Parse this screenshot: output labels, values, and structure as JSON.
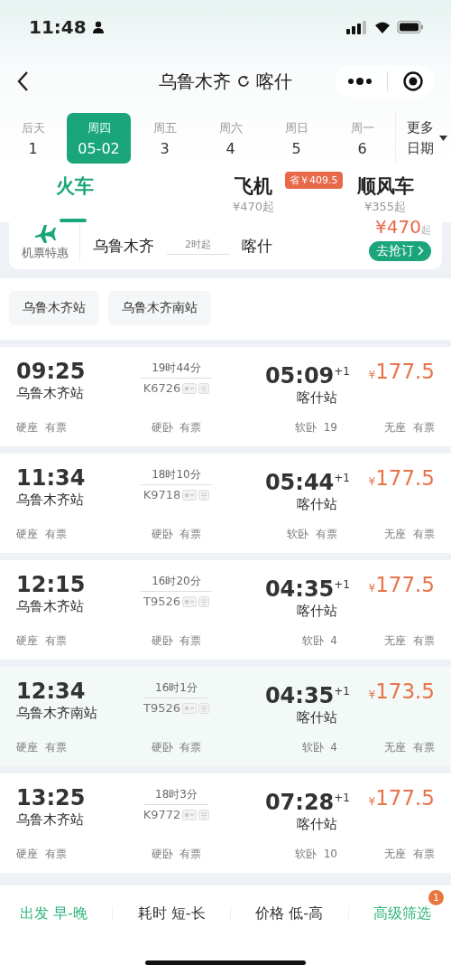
{
  "status_bar": {
    "time": "11:48"
  },
  "nav": {
    "from": "乌鲁木齐",
    "to": "喀什"
  },
  "dates": [
    {
      "weekday": "后天",
      "date": "1",
      "selected": false
    },
    {
      "weekday": "周四",
      "date": "05-02",
      "selected": true
    },
    {
      "weekday": "周五",
      "date": "3",
      "selected": false
    },
    {
      "weekday": "周六",
      "date": "4",
      "selected": false
    },
    {
      "weekday": "周日",
      "date": "5",
      "selected": false
    },
    {
      "weekday": "周一",
      "date": "6",
      "selected": false
    }
  ],
  "more_dates": {
    "line_1": "更多",
    "line_2": "日期"
  },
  "tabs": [
    {
      "label": "火车",
      "selected": true
    },
    {
      "label": "飞机",
      "price": "¥470起",
      "badge": "省￥409.5",
      "selected": false
    },
    {
      "label": "顺风车",
      "price": "¥355起",
      "selected": false
    }
  ],
  "flight_promo": {
    "label": "机票特惠",
    "from": "乌鲁木齐",
    "duration": "2时起",
    "to": "喀什",
    "price": "¥470",
    "price_suffix": "起",
    "button": "去抢订"
  },
  "station_filters": [
    {
      "label": "乌鲁木齐站",
      "selected": false
    },
    {
      "label": "乌鲁木齐南站",
      "selected": false
    }
  ],
  "trains": [
    {
      "depart": "09:25",
      "from": "乌鲁木齐站",
      "duration": "19时44分",
      "number": "K6726",
      "arrive": "05:09",
      "day_offset": "+1",
      "to": "喀什站",
      "price": "177.5",
      "currency": "¥",
      "selected": false,
      "seats": [
        {
          "type": "硬座",
          "status": "有票"
        },
        {
          "type": "硬卧",
          "status": "有票"
        },
        {
          "type": "软卧",
          "status": "19"
        },
        {
          "type": "无座",
          "status": "有票"
        }
      ]
    },
    {
      "depart": "11:34",
      "from": "乌鲁木齐站",
      "duration": "18时10分",
      "number": "K9718",
      "arrive": "05:44",
      "day_offset": "+1",
      "to": "喀什站",
      "price": "177.5",
      "currency": "¥",
      "selected": false,
      "seats": [
        {
          "type": "硬座",
          "status": "有票"
        },
        {
          "type": "硬卧",
          "status": "有票"
        },
        {
          "type": "软卧",
          "status": "有票"
        },
        {
          "type": "无座",
          "status": "有票"
        }
      ]
    },
    {
      "depart": "12:15",
      "from": "乌鲁木齐站",
      "duration": "16时20分",
      "number": "T9526",
      "arrive": "04:35",
      "day_offset": "+1",
      "to": "喀什站",
      "price": "177.5",
      "currency": "¥",
      "selected": false,
      "seats": [
        {
          "type": "硬座",
          "status": "有票"
        },
        {
          "type": "硬卧",
          "status": "有票"
        },
        {
          "type": "软卧",
          "status": "4"
        },
        {
          "type": "无座",
          "status": "有票"
        }
      ]
    },
    {
      "depart": "12:34",
      "from": "乌鲁木齐南站",
      "duration": "16时1分",
      "number": "T9526",
      "arrive": "04:35",
      "day_offset": "+1",
      "to": "喀什站",
      "price": "173.5",
      "currency": "¥",
      "selected": true,
      "seats": [
        {
          "type": "硬座",
          "status": "有票"
        },
        {
          "type": "硬卧",
          "status": "有票"
        },
        {
          "type": "软卧",
          "status": "4"
        },
        {
          "type": "无座",
          "status": "有票"
        }
      ]
    },
    {
      "depart": "13:25",
      "from": "乌鲁木齐站",
      "duration": "18时3分",
      "number": "K9772",
      "arrive": "07:28",
      "day_offset": "+1",
      "to": "喀什站",
      "price": "177.5",
      "currency": "¥",
      "selected": false,
      "seats": [
        {
          "type": "硬座",
          "status": "有票"
        },
        {
          "type": "硬卧",
          "status": "有票"
        },
        {
          "type": "软卧",
          "status": "10"
        },
        {
          "type": "无座",
          "status": "有票"
        }
      ]
    }
  ],
  "sort_bar": [
    {
      "kind": "sort",
      "label": "出发 早-晚",
      "selected": true
    },
    {
      "kind": "sort",
      "label": "耗时 短-长",
      "selected": false
    },
    {
      "kind": "sort",
      "label": "价格 低-高",
      "selected": false
    },
    {
      "kind": "filter",
      "label": "高级筛选",
      "count": "1",
      "selected": true
    }
  ]
}
